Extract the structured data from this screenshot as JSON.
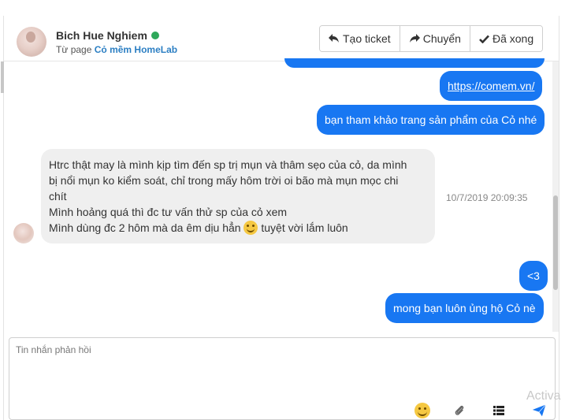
{
  "contact": {
    "name": "Bich Hue Nghiem",
    "source_prefix": "Từ page",
    "page_name": "Cỏ mềm HomeLab",
    "online_color": "#2ea85a"
  },
  "actions": {
    "create_ticket": "Tạo ticket",
    "transfer": "Chuyển",
    "done": "Đã xong"
  },
  "messages": {
    "outgoing_link": "https://comem.vn/",
    "outgoing_1": "bạn tham khảo trang sản phẩm của Cỏ nhé",
    "incoming_line1": "Htrc thật may là mình kịp tìm đến sp trị mụn và thâm sẹo của cỏ, da mình",
    "incoming_line2": "bị nổi mụn ko kiểm soát, chỉ trong mấy hôm trời oi bão mà mụn mọc chi",
    "incoming_line3": "chít",
    "incoming_line4": "Mình hoảng quá thì đc tư vấn thử sp của cỏ xem",
    "incoming_line5_a": "Mình dùng đc 2 hôm mà da êm dịu hẳn",
    "incoming_line5_b": "tuyệt vời lắm luôn",
    "incoming_time": "10/7/2019 20:09:35",
    "outgoing_2": "<3",
    "outgoing_3": "mong bạn luôn ủng hộ Cỏ nè"
  },
  "composer": {
    "placeholder": "Tin nhắn phản hồi"
  },
  "watermark": "Activa",
  "colors": {
    "outgoing_bubble": "#1877f2",
    "incoming_bubble": "#efefef",
    "link": "#2c7fc3"
  },
  "icons": [
    "reply-icon",
    "forward-icon",
    "check-icon",
    "emoji-icon",
    "paperclip-icon",
    "list-icon",
    "send-icon"
  ]
}
